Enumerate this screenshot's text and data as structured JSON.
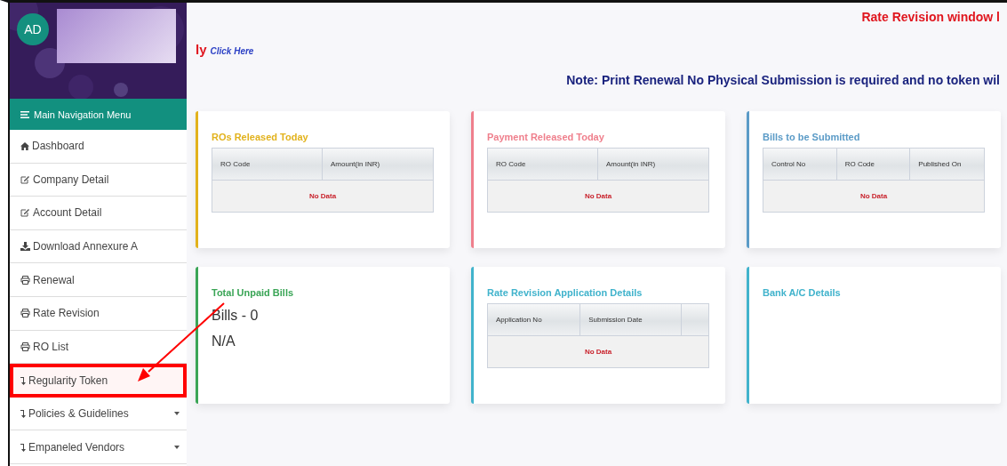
{
  "user": {
    "initials": "AD"
  },
  "sidebar": {
    "title": "Main Navigation Menu",
    "items": [
      {
        "label": "Dashboard",
        "kind": "home",
        "dropdown": false,
        "highlighted": false
      },
      {
        "label": "Company Detail",
        "kind": "edit",
        "dropdown": false,
        "highlighted": false
      },
      {
        "label": "Account Detail",
        "kind": "edit",
        "dropdown": false,
        "highlighted": false
      },
      {
        "label": "Download Annexure A",
        "kind": "download",
        "dropdown": false,
        "highlighted": false
      },
      {
        "label": "Renewal",
        "kind": "print",
        "dropdown": false,
        "highlighted": false
      },
      {
        "label": "Rate Revision",
        "kind": "print",
        "dropdown": false,
        "highlighted": false
      },
      {
        "label": "RO List",
        "kind": "print",
        "dropdown": false,
        "highlighted": false
      },
      {
        "label": "Regularity Token",
        "kind": "turn",
        "dropdown": false,
        "highlighted": true
      },
      {
        "label": "Policies & Guidelines",
        "kind": "turn",
        "dropdown": true,
        "highlighted": false
      },
      {
        "label": "Empaneled Vendors",
        "kind": "turn",
        "dropdown": true,
        "highlighted": false
      }
    ]
  },
  "notices": {
    "banner": "Rate Revision window l",
    "fragment": "ly",
    "link": "Click Here",
    "note": "Note: Print Renewal No Physical Submission is required and no token wil"
  },
  "cards": [
    {
      "kind": "table",
      "title": "ROs Released Today",
      "color": "#e2b21c",
      "columns": [
        "RO Code",
        "Amount(in INR)"
      ],
      "empty": "No Data"
    },
    {
      "kind": "table",
      "title": "Payment Released Today",
      "color": "#ef7f8c",
      "columns": [
        "RO Code",
        "Amount(in INR)"
      ],
      "empty": "No Data"
    },
    {
      "kind": "table",
      "title": "Bills to be Submitted",
      "color": "#5b9bc7",
      "columns": [
        "Control No",
        "RO Code",
        "Published On"
      ],
      "empty": "No Data"
    },
    {
      "kind": "summary",
      "title": "Total Unpaid Bills",
      "color": "#3aa556",
      "lines": [
        "Bills - 0",
        "N/A"
      ]
    },
    {
      "kind": "table",
      "title": "Rate Revision Application Details",
      "color": "#41b3cc",
      "columns": [
        "Application No",
        "Submission Date",
        ""
      ],
      "empty": "No Data"
    },
    {
      "kind": "blank",
      "title": "Bank A/C Details",
      "color": "#41b3cc"
    }
  ]
}
